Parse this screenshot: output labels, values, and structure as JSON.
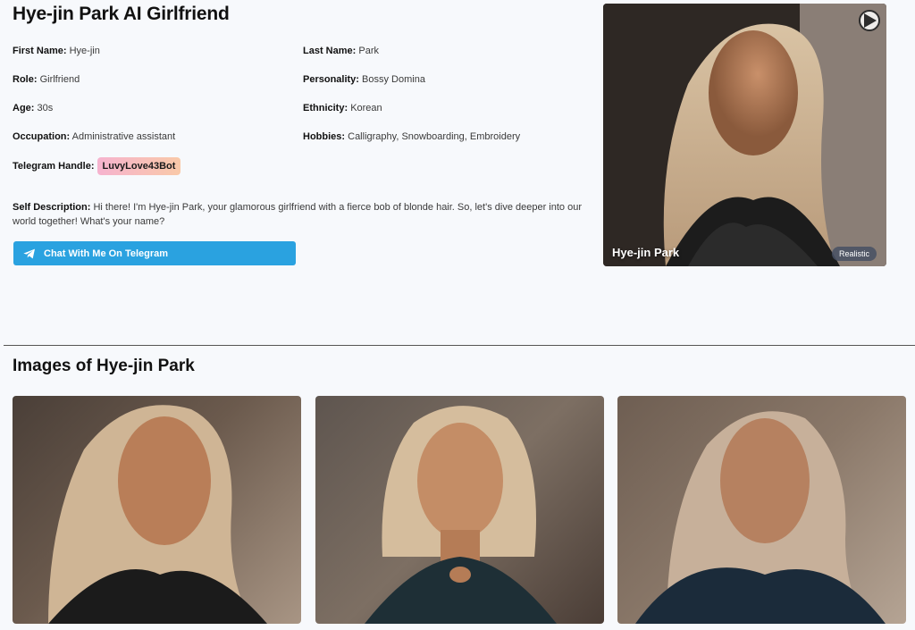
{
  "page": {
    "title": "Hye-jin Park AI Girlfriend"
  },
  "profile": {
    "first_name_label": "First Name:",
    "first_name": "Hye-jin",
    "last_name_label": "Last Name:",
    "last_name": "Park",
    "role_label": "Role:",
    "role": "Girlfriend",
    "personality_label": "Personality:",
    "personality": "Bossy Domina",
    "age_label": "Age:",
    "age": "30s",
    "ethnicity_label": "Ethnicity:",
    "ethnicity": "Korean",
    "occupation_label": "Occupation:",
    "occupation": "Administrative assistant",
    "hobbies_label": "Hobbies:",
    "hobbies": "Calligraphy, Snowboarding, Embroidery",
    "telegram_label": "Telegram Handle:",
    "telegram_handle": "LuvyLove43Bot",
    "self_description_label": "Self Description:",
    "self_description": "Hi there! I'm Hye-jin Park, your glamorous girlfriend with a fierce bob of blonde hair. So, let's dive deeper into our world together! What's your name?"
  },
  "cta": {
    "telegram_button": "Chat With Me On Telegram"
  },
  "hero": {
    "name": "Hye-jin Park",
    "tag": "Realistic"
  },
  "gallery": {
    "title": "Images of Hye-jin Park"
  },
  "colors": {
    "telegram_blue": "#2aa2e0",
    "background": "#f7f9fc"
  }
}
